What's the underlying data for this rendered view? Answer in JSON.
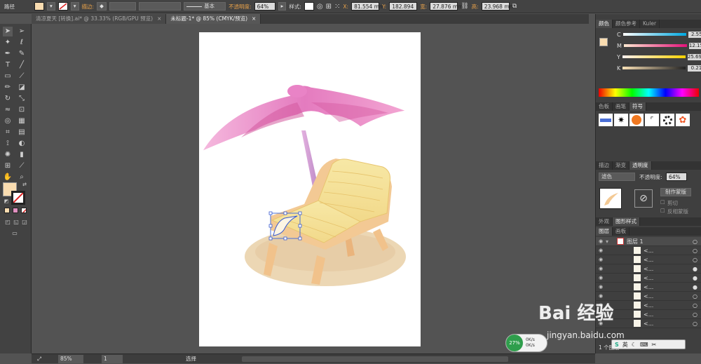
{
  "control_bar": {
    "selection_label": "路径",
    "stroke_label": "描边:",
    "profile_label": "基本",
    "opacity_label": "不透明度:",
    "opacity_value": "64%",
    "style_label": "样式:",
    "x_label": "X:",
    "x_value": "81.554 mm",
    "y_label": "Y:",
    "y_value": "182.894",
    "w_label": "宽:",
    "w_value": "27.876 mm",
    "h_label": "高:",
    "h_value": "23.968 mm",
    "fill_color": "#f9dcb0"
  },
  "doc_tabs": [
    {
      "label": "清凉夏天 [转换].ai* @ 33.33% (RGB/GPU 预览)",
      "close": "×"
    },
    {
      "label": "未标题-1* @ 85% (CMYK/预览)",
      "close": "×"
    }
  ],
  "color_panel": {
    "tabs": [
      "颜色",
      "颜色参考",
      "Kuler"
    ],
    "channels": [
      {
        "name": "C",
        "value": "2.55",
        "unit": "%"
      },
      {
        "name": "M",
        "value": "12.15",
        "unit": "%"
      },
      {
        "name": "Y",
        "value": "25.69",
        "unit": "%"
      },
      {
        "name": "K",
        "value": "0.21",
        "unit": "%"
      }
    ],
    "swatch_color": "#f9dcb0"
  },
  "symbols_panel": {
    "tabs": [
      "色板",
      "画笔",
      "符号"
    ],
    "icon_names": [
      "blue-ribbon",
      "ink-splat",
      "orange-sphere",
      "grunge-frame",
      "black-ring",
      "orange-flower"
    ]
  },
  "transparency_panel": {
    "tabs": [
      "描边",
      "渐变",
      "透明度"
    ],
    "blend_mode": "滤色",
    "opacity_label": "不透明度:",
    "opacity_value": "64%",
    "make_mask_button": "制作蒙版",
    "clip_label": "剪切",
    "invert_label": "反相蒙版"
  },
  "appearance_tabs": [
    "外观",
    "图形样式"
  ],
  "layers_panel": {
    "tabs": [
      "图层",
      "画板"
    ],
    "top_layer": "图层 1",
    "sub_items": [
      "<...",
      "<...",
      "<...",
      "<...",
      "<...",
      "<...",
      "<...",
      "<...",
      "<..."
    ],
    "footer": "1 个图层"
  },
  "status_bar": {
    "zoom": "85%",
    "page": "1",
    "tool": "选择"
  },
  "overlay": {
    "badge_percent": "27%",
    "badge_upload": "0K/s",
    "badge_download": "0K/s",
    "ime_label": "英",
    "watermark_logo": "Bai 经验",
    "watermark_url": "jingyan.baidu.com"
  }
}
